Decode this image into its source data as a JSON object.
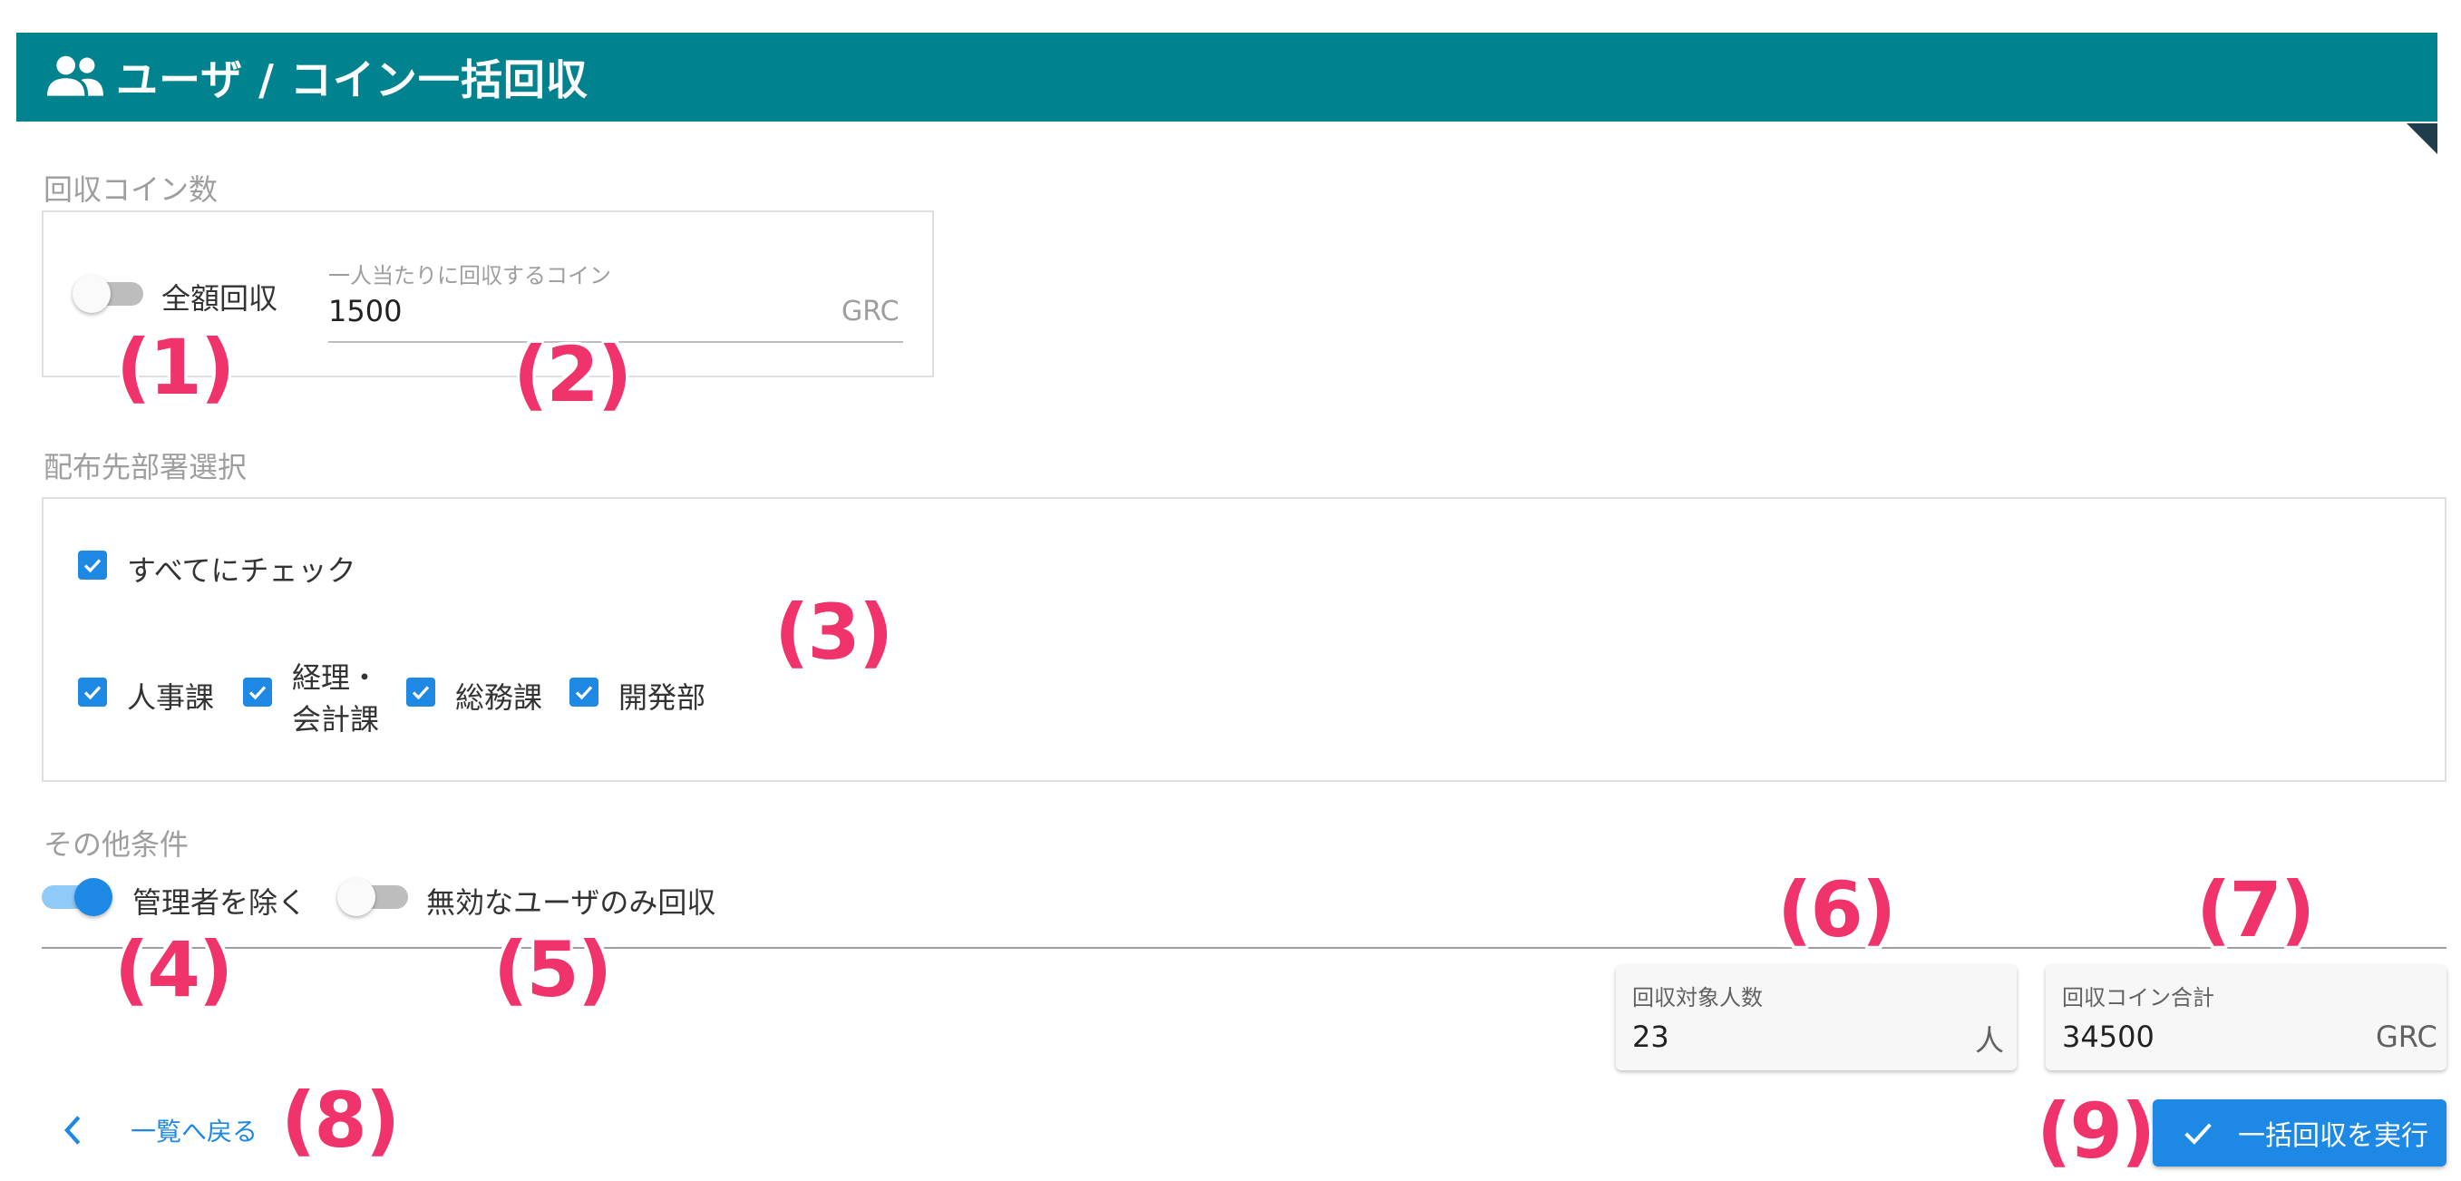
{
  "header": {
    "title": "ユーザ / コイン一括回収",
    "icon": "users-icon",
    "color": "#00838f"
  },
  "collect": {
    "section_label": "回収コイン数",
    "full_toggle_label": "全額回収",
    "full_toggle_on": false,
    "per_user_label": "一人当たりに回収するコイン",
    "per_user_value": "1500",
    "per_user_unit": "GRC"
  },
  "departments": {
    "section_label": "配布先部署選択",
    "select_all_label": "すべてにチェック",
    "items": [
      {
        "label": "人事課",
        "checked": true
      },
      {
        "label_line1": "経理・",
        "label_line2": "会計課",
        "checked": true
      },
      {
        "label": "総務課",
        "checked": true
      },
      {
        "label": "開発部",
        "checked": true
      }
    ]
  },
  "other": {
    "section_label": "その他条件",
    "exclude_admin_label": "管理者を除く",
    "exclude_admin_on": true,
    "invalid_only_label": "無効なユーザのみ回収",
    "invalid_only_on": false
  },
  "summary": {
    "target_label": "回収対象人数",
    "target_value": "23",
    "target_unit": "人",
    "total_label": "回収コイン合計",
    "total_value": "34500",
    "total_unit": "GRC"
  },
  "footer": {
    "back_label": "一覧へ戻る",
    "execute_label": "一括回収を実行"
  },
  "callouts": [
    "(1)",
    "(2)",
    "(3)",
    "(4)",
    "(5)",
    "(6)",
    "(7)",
    "(8)",
    "(9)"
  ],
  "colors": {
    "accent": "#1e88e5",
    "callout": "#f0336b"
  }
}
